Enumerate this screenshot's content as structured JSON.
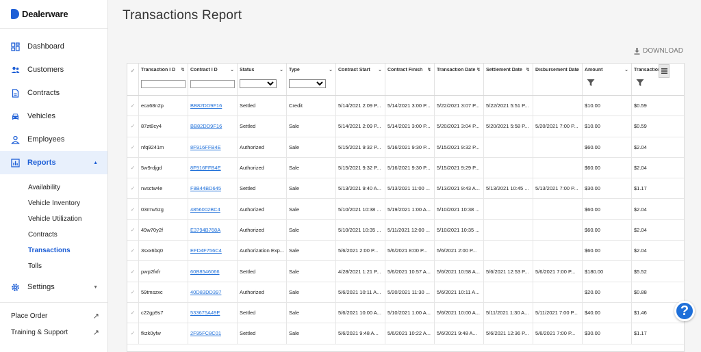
{
  "brand": {
    "name": "Dealerware"
  },
  "nav": {
    "items": [
      {
        "label": "Dashboard",
        "icon": "dashboard-icon"
      },
      {
        "label": "Customers",
        "icon": "customers-icon"
      },
      {
        "label": "Contracts",
        "icon": "contracts-icon"
      },
      {
        "label": "Vehicles",
        "icon": "car-icon"
      },
      {
        "label": "Employees",
        "icon": "person-icon"
      },
      {
        "label": "Reports",
        "icon": "reports-icon"
      }
    ],
    "reports_sub": [
      "Availability",
      "Vehicle Inventory",
      "Vehicle Utilization",
      "Contracts",
      "Transactions",
      "Tolls"
    ],
    "settings": {
      "label": "Settings",
      "icon": "gear-icon"
    },
    "external": [
      {
        "label": "Place Order"
      },
      {
        "label": "Training & Support"
      }
    ],
    "active_item": "Reports",
    "active_sub": "Transactions"
  },
  "page": {
    "title": "Transactions Report",
    "download_label": "DOWNLOAD"
  },
  "table": {
    "columns": [
      "Transaction I D",
      "Contract I D",
      "Status",
      "Type",
      "Contract Start",
      "Contract Finish",
      "Transaction Date",
      "Settlement Date",
      "Disbursement Date",
      "Amount",
      "Transaction Fee"
    ],
    "rows": [
      [
        "eca68n2p",
        "BB82DD9F16",
        "Settled",
        "Credit",
        "5/14/2021 2:09 P...",
        "5/14/2021 3:00 P...",
        "5/22/2021 3:07 P...",
        "5/22/2021 5:51 P...",
        "",
        "$10.00",
        "$0.59"
      ],
      [
        "87zt8cy4",
        "BB82DD9F16",
        "Settled",
        "Sale",
        "5/14/2021 2:09 P...",
        "5/14/2021 3:00 P...",
        "5/20/2021 3:04 P...",
        "5/20/2021 5:58 P...",
        "5/20/2021 7:00 P...",
        "$10.00",
        "$0.59"
      ],
      [
        "nfq9241m",
        "8F916FFB4E",
        "Authorized",
        "Sale",
        "5/15/2021 9:32 P...",
        "5/16/2021 9:30 P...",
        "5/15/2021 9:32 P...",
        "",
        "",
        "$60.00",
        "$2.04"
      ],
      [
        "5w9rdjgd",
        "8F916FFB4E",
        "Authorized",
        "Sale",
        "5/15/2021 9:32 P...",
        "5/16/2021 9:30 P...",
        "5/15/2021 9:29 P...",
        "",
        "",
        "$60.00",
        "$2.04"
      ],
      [
        "nvsctw4e",
        "F8B44BD645",
        "Settled",
        "Sale",
        "5/13/2021 9:40 A...",
        "5/13/2021 11:00 ...",
        "5/13/2021 9:43 A...",
        "5/13/2021 10:45 ...",
        "5/13/2021 7:00 P...",
        "$30.00",
        "$1.17"
      ],
      [
        "03rmv5zg",
        "4856002BC4",
        "Authorized",
        "Sale",
        "5/10/2021 10:38 ...",
        "5/19/2021 1:00 A...",
        "5/10/2021 10:38 ...",
        "",
        "",
        "$60.00",
        "$2.04"
      ],
      [
        "49w70y2f",
        "E3794B768A",
        "Authorized",
        "Sale",
        "5/10/2021 10:35 ...",
        "5/11/2021 12:00 ...",
        "5/10/2021 10:35 ...",
        "",
        "",
        "$60.00",
        "$2.04"
      ],
      [
        "3sxx6bq0",
        "EFD4F756C4",
        "Authorization Exp...",
        "Sale",
        "5/6/2021 2:00 P...",
        "5/6/2021 8:00 P...",
        "5/6/2021 2:00 P...",
        "",
        "",
        "$60.00",
        "$2.04"
      ],
      [
        "pwp2fxfr",
        "60B8546066",
        "Settled",
        "Sale",
        "4/28/2021 1:21 P...",
        "5/6/2021 10:57 A...",
        "5/6/2021 10:58 A...",
        "5/6/2021 12:53 P...",
        "5/6/2021 7:00 P...",
        "$180.00",
        "$5.52"
      ],
      [
        "59tmszxc",
        "40D83DD397",
        "Authorized",
        "Sale",
        "5/6/2021 10:11 A...",
        "5/20/2021 11:30 ...",
        "5/6/2021 10:11 A...",
        "",
        "",
        "$20.00",
        "$0.88"
      ],
      [
        "c22gp9s7",
        "533675A49E",
        "Settled",
        "Sale",
        "5/6/2021 10:00 A...",
        "5/10/2021 1:00 A...",
        "5/6/2021 10:00 A...",
        "5/11/2021 1:30 A...",
        "5/11/2021 7:00 P...",
        "$40.00",
        "$1.46"
      ],
      [
        "fkzk0yfw",
        "2F95FC8C01",
        "Settled",
        "Sale",
        "5/6/2021 9:48 A...",
        "5/6/2021 10:22 A...",
        "5/6/2021 9:48 A...",
        "5/6/2021 12:36 P...",
        "5/6/2021 7:00 P...",
        "$30.00",
        "$1.17"
      ]
    ]
  },
  "help": {
    "label": "?"
  },
  "colors": {
    "accent": "#1e5fd6",
    "link": "#1e6fd9"
  }
}
